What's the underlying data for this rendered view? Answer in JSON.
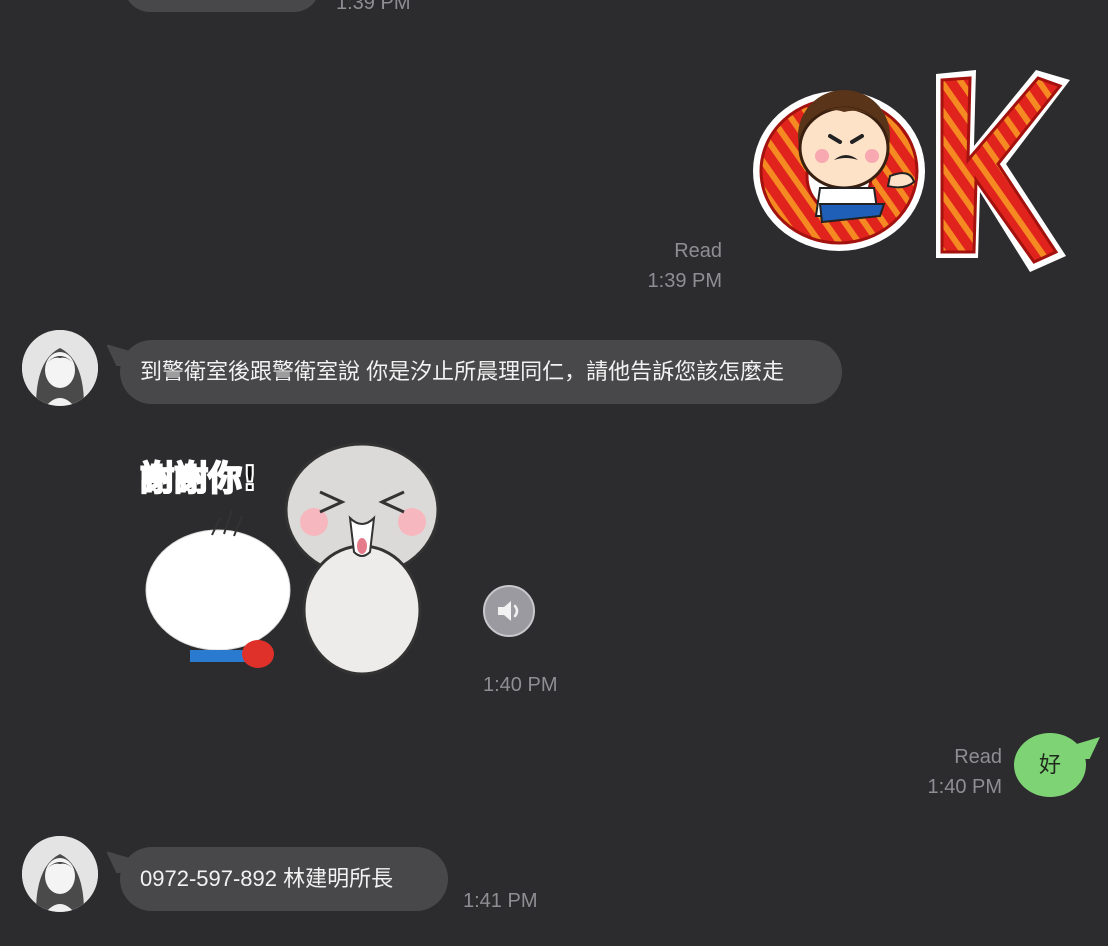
{
  "messages": [
    {
      "id": "m0",
      "direction": "in",
      "type": "text",
      "time": "1:39 PM"
    },
    {
      "id": "m1",
      "direction": "out",
      "type": "sticker",
      "sticker_name": "OK",
      "status": "Read",
      "time": "1:39 PM"
    },
    {
      "id": "m2",
      "direction": "in",
      "type": "text",
      "text": "到警衛室後跟警衛室說 你是汐止所晨理同仁，請他告訴您該怎麼走"
    },
    {
      "id": "m3",
      "direction": "in",
      "type": "sticker",
      "sticker_caption": "謝謝你!",
      "time": "1:40 PM",
      "has_sound": true
    },
    {
      "id": "m4",
      "direction": "out",
      "type": "text",
      "text": "好",
      "status": "Read",
      "time": "1:40 PM"
    },
    {
      "id": "m5",
      "direction": "in",
      "type": "text",
      "text": "0972-597-892 林建明所長",
      "time": "1:41 PM"
    }
  ],
  "colors": {
    "background": "#2c2c2e",
    "incoming_bubble": "#48484a",
    "outgoing_bubble": "#7ed374",
    "meta_text": "#8e8e93"
  }
}
